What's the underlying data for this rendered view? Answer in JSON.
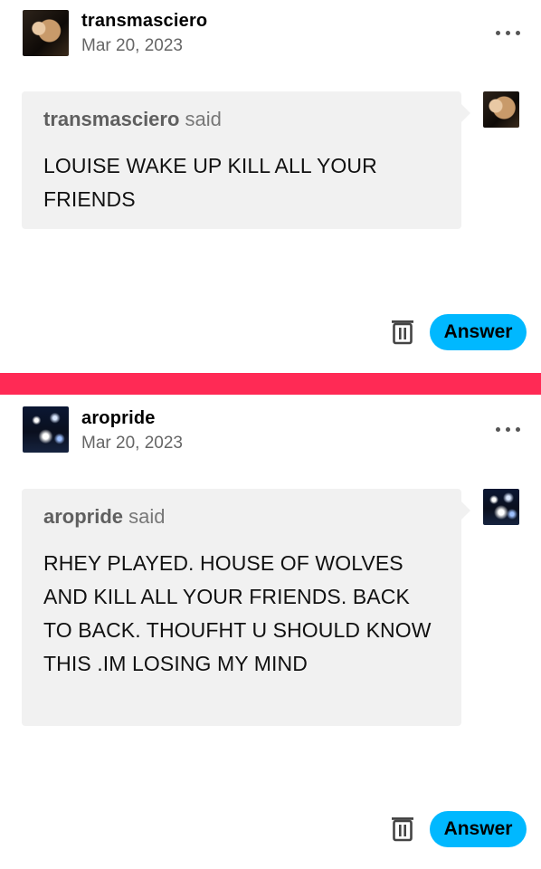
{
  "posts": [
    {
      "username": "transmasciero",
      "date": "Mar 20, 2023",
      "avatar_icon": "user-photo-avatar",
      "ask": {
        "asker": "transmasciero",
        "said": "said",
        "message": "LOUISE WAKE UP KILL ALL YOUR FRIENDS"
      },
      "answer_label": "Answer"
    },
    {
      "username": "aropride",
      "date": "Mar 20, 2023",
      "avatar_icon": "concert-lights-avatar",
      "ask": {
        "asker": "aropride",
        "said": "said",
        "message": "RHEY PLAYED. HOUSE OF WOLVES AND KILL ALL YOUR FRIENDS. BACK TO BACK. THOUFHT U SHOULD KNOW THIS .IM LOSING MY MIND"
      },
      "answer_label": "Answer"
    }
  ],
  "colors": {
    "divider": "#ff2a55",
    "answer_button": "#00b8ff",
    "bubble_bg": "#f1f1f1"
  }
}
